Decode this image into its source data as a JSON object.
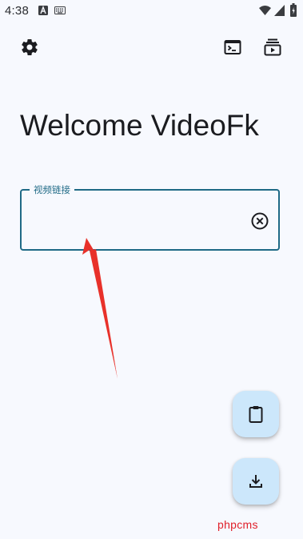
{
  "status_bar": {
    "time": "4:38"
  },
  "top_bar": {
    "settings_icon": "gear-icon",
    "terminal_icon": "terminal-icon",
    "queue_icon": "playlist-icon"
  },
  "main": {
    "title": "Welcome VideoFk",
    "url_field": {
      "label": "视频链接",
      "value": "",
      "clear_icon": "cancel-circle-icon"
    }
  },
  "fabs": {
    "paste_icon": "clipboard-icon",
    "download_icon": "download-icon"
  },
  "annotation": {
    "arrow_color": "#e8312a"
  },
  "watermark": {
    "text": "phpcms"
  },
  "colors": {
    "background": "#f7f9fe",
    "accent": "#1f6a86",
    "fab_background": "#cce7fb"
  }
}
